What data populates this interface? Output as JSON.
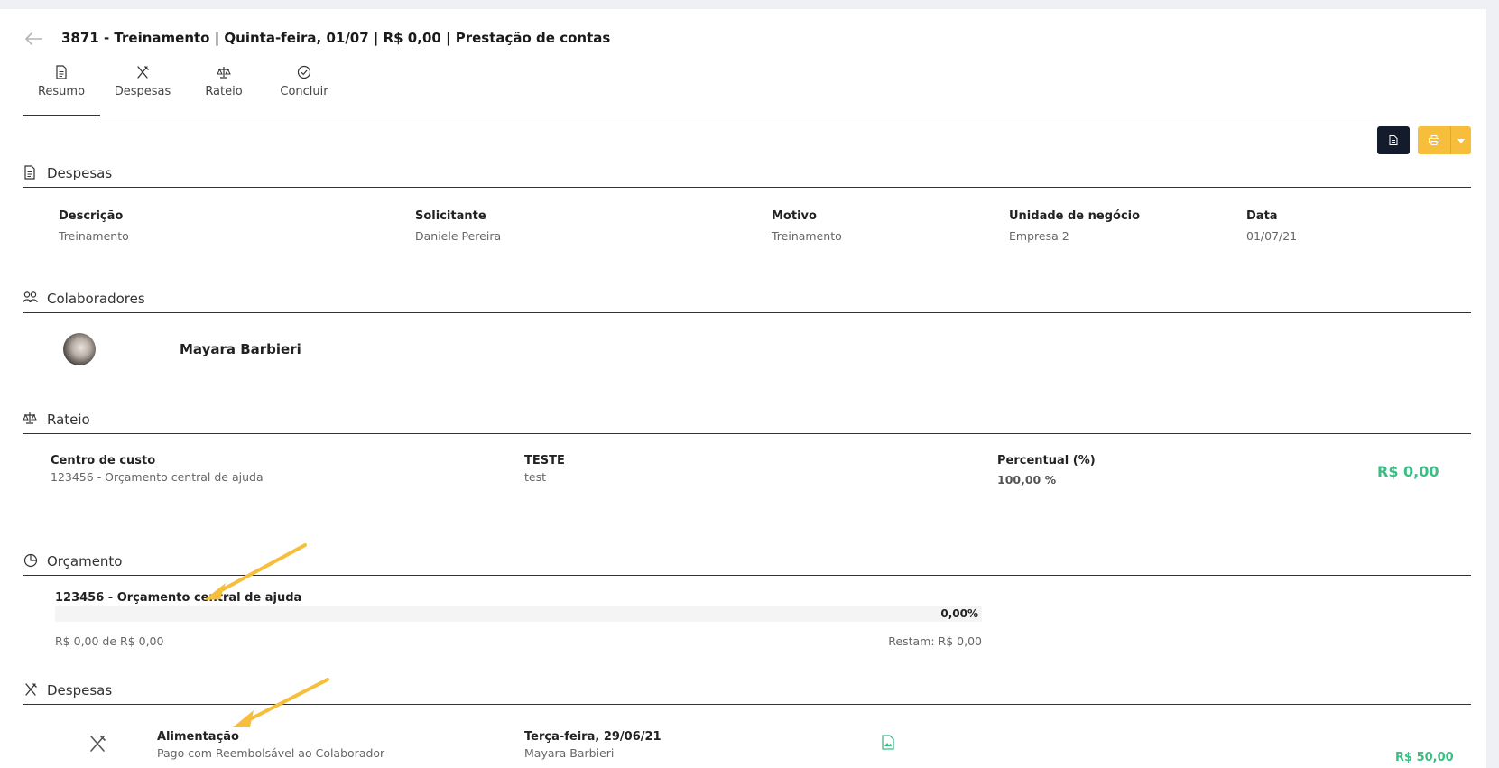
{
  "header": {
    "title": "3871 - Treinamento | Quinta-feira, 01/07 | R$ 0,00 | Prestação de contas"
  },
  "tabs": [
    {
      "label": "Resumo",
      "icon": "document-icon",
      "active": true
    },
    {
      "label": "Despesas",
      "icon": "utensils-icon"
    },
    {
      "label": "Rateio",
      "icon": "scale-icon"
    },
    {
      "label": "Concluir",
      "icon": "check-circle-icon"
    }
  ],
  "toolbar": {
    "doc_icon": "document-icon",
    "print_icon": "printer-icon",
    "dropdown_icon": "caret-down-icon"
  },
  "despesas": {
    "title": "Despesas",
    "fields": [
      {
        "label": "Descrição",
        "value": "Treinamento"
      },
      {
        "label": "Solicitante",
        "value": "Daniele Pereira"
      },
      {
        "label": "Motivo",
        "value": "Treinamento"
      },
      {
        "label": "Unidade de negócio",
        "value": "Empresa 2"
      },
      {
        "label": "Data",
        "value": "01/07/21"
      }
    ]
  },
  "colaboradores": {
    "title": "Colaboradores",
    "people": [
      {
        "name": "Mayara Barbieri"
      }
    ]
  },
  "rateio": {
    "title": "Rateio",
    "centro_label": "Centro de custo",
    "centro_value": "123456 - Orçamento central de ajuda",
    "teste_label": "TESTE",
    "teste_value": "test",
    "percentual_label": "Percentual (%)",
    "percentual_value": "100,00 %",
    "amount": "R$ 0,00"
  },
  "orcamento": {
    "title": "Orçamento",
    "name": "123456 - Orçamento central de ajuda",
    "percent_text": "0,00%",
    "progress": 0,
    "used_text": "R$ 0,00 de R$ 0,00",
    "remaining_text": "Restam: R$ 0,00"
  },
  "despesas_list": {
    "title": "Despesas",
    "items": [
      {
        "category": "Alimentação",
        "payment": "Pago com Reembolsável ao Colaborador",
        "date": "Terça-feira, 29/06/21",
        "person": "Mayara Barbieri",
        "amount": "R$ 50,00"
      }
    ]
  },
  "colors": {
    "accent_green": "#3bbd84",
    "print_button": "#f6be3a",
    "dark_button": "#141b2d",
    "arrow": "#f6be3a"
  }
}
